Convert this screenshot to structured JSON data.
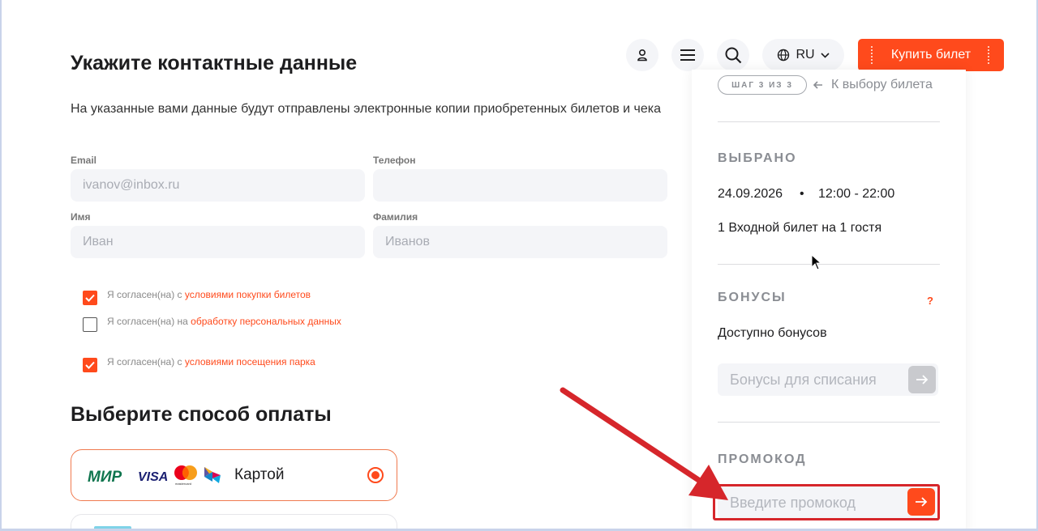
{
  "header": {
    "lang": "RU",
    "buy_label": "Купить билет",
    "icons": [
      "user-icon",
      "menu-icon",
      "search-icon",
      "globe-icon"
    ]
  },
  "contact": {
    "title": "Укажите контактные данные",
    "lead": "На указанные вами данные будут отправлены электронные копии приобретенных билетов и чека",
    "email_label": "Email",
    "email_placeholder": "ivanov@inbox.ru",
    "phone_label": "Телефон",
    "phone_value": "",
    "name_label": "Имя",
    "name_placeholder": "Иван",
    "surname_label": "Фамилия",
    "surname_placeholder": "Иванов"
  },
  "consents": [
    {
      "prefix": "Я согласен(на) с ",
      "link": "условиями покупки билетов",
      "checked": true
    },
    {
      "prefix": "Я согласен(на) на ",
      "link": "обработку персональных данных",
      "checked": false
    },
    {
      "prefix": "Я согласен(на) с ",
      "link": "условиями посещения парка",
      "checked": true
    }
  ],
  "payment": {
    "title": "Выберите способ оплаты",
    "card_label": "Картой",
    "brands": [
      "МИР",
      "VISA",
      "mastercard",
      "СБП"
    ],
    "selected": true
  },
  "panel": {
    "step": "ШАГ 3 ИЗ 3",
    "back_label": "К выбору билета",
    "selected_title": "ВЫБРАНО",
    "date": "24.09.2026",
    "dot": "•",
    "time": "12:00 - 22:00",
    "ticket": "1 Входной билет на 1 гостя",
    "bonus_title": "БОНУСЫ",
    "bonus_help": "?",
    "bonus_available": "Доступно бонусов",
    "bonus_placeholder": "Бонусы для списания",
    "promo_title": "ПРОМОКОД",
    "promo_placeholder": "Введите промокод"
  },
  "colors": {
    "accent": "#ff4a1c",
    "annotation_red": "#d6262b",
    "field_bg": "#f4f5f8"
  }
}
